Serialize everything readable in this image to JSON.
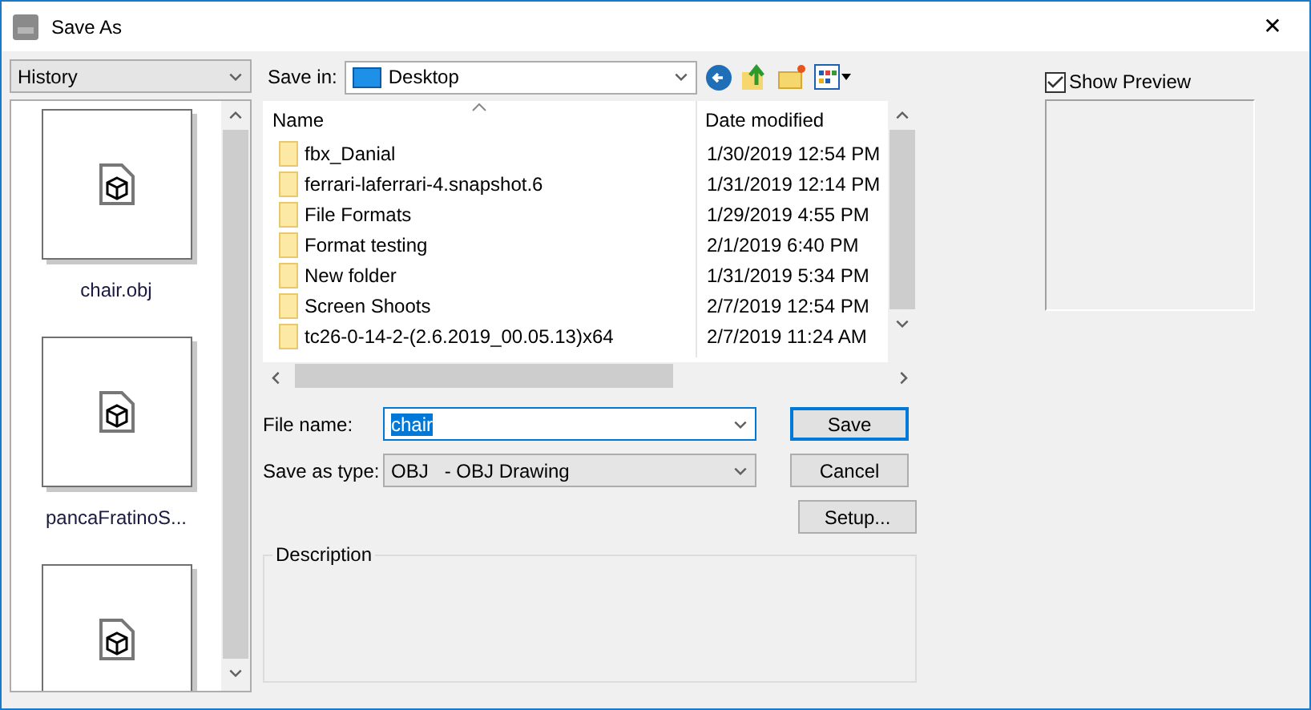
{
  "window": {
    "title": "Save As",
    "close": "✕"
  },
  "history": {
    "value": "History",
    "items": [
      {
        "kind": "labeled",
        "label": "chair.obj"
      },
      {
        "kind": "labeled",
        "label": "pancaFratinoS..."
      },
      {
        "kind": "unlabeled"
      }
    ]
  },
  "save_in": {
    "label": "Save in:",
    "value": "Desktop"
  },
  "file_list": {
    "columns": [
      "Name",
      "Date modified"
    ],
    "rows": [
      {
        "name": "fbx_Danial",
        "date": "1/30/2019 12:54 PM"
      },
      {
        "name": "ferrari-laferrari-4.snapshot.6",
        "date": "1/31/2019 12:14 PM"
      },
      {
        "name": "File Formats",
        "date": "1/29/2019 4:55 PM"
      },
      {
        "name": "Format testing",
        "date": "2/1/2019 6:40 PM"
      },
      {
        "name": "New folder",
        "date": "1/31/2019 5:34 PM"
      },
      {
        "name": "Screen Shoots",
        "date": "2/7/2019 12:54 PM"
      },
      {
        "name": "tc26-0-14-2-(2.6.2019_00.05.13)x64",
        "date": "2/7/2019 11:24 AM"
      }
    ]
  },
  "file_name": {
    "label": "File name:",
    "value": "chair"
  },
  "save_as_type": {
    "label": "Save as type:",
    "value": "OBJ   - OBJ Drawing"
  },
  "buttons": [
    {
      "label": "Save",
      "default": true
    },
    {
      "label": "Cancel",
      "default": false
    },
    {
      "label": "Setup...",
      "default": false
    }
  ],
  "description": {
    "label": "Description"
  },
  "show_preview": {
    "label": "Show Preview",
    "checked": true
  }
}
